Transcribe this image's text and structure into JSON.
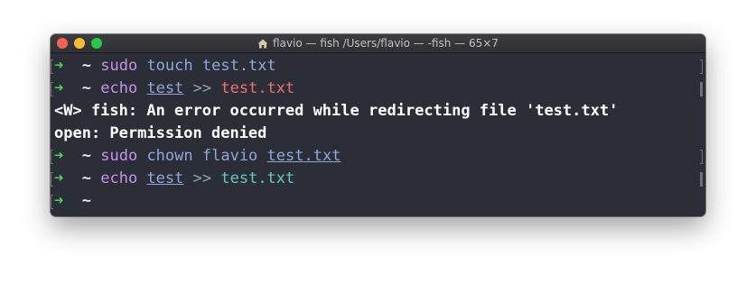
{
  "window": {
    "title": "flavio — fish /Users/flavio — -fish — 65×7"
  },
  "terminal": {
    "prompt_arrow": "➜",
    "prompt_dir": "~",
    "lines": [
      {
        "cmd": "sudo",
        "a1": "touch",
        "a2": "test.txt"
      },
      {
        "cmd": "echo",
        "a1": "test",
        "redir": ">>",
        "file": "test.txt"
      },
      {
        "text": "<W> fish: An error occurred while redirecting file 'test.txt'"
      },
      {
        "text": "open: Permission denied"
      },
      {
        "cmd": "sudo",
        "a1": "chown",
        "a2": "flavio",
        "a3": "test.txt"
      },
      {
        "cmd": "echo",
        "a1": "test",
        "redir": ">>",
        "file": "test.txt"
      }
    ]
  },
  "colors": {
    "background": "#2b2e36",
    "arrow": "#4ed45b",
    "command": "#c792ea",
    "argument": "#8fa7dc",
    "error_file": "#f07070",
    "ok_file": "#66c8c4"
  },
  "icons": {
    "title": "home-icon"
  }
}
